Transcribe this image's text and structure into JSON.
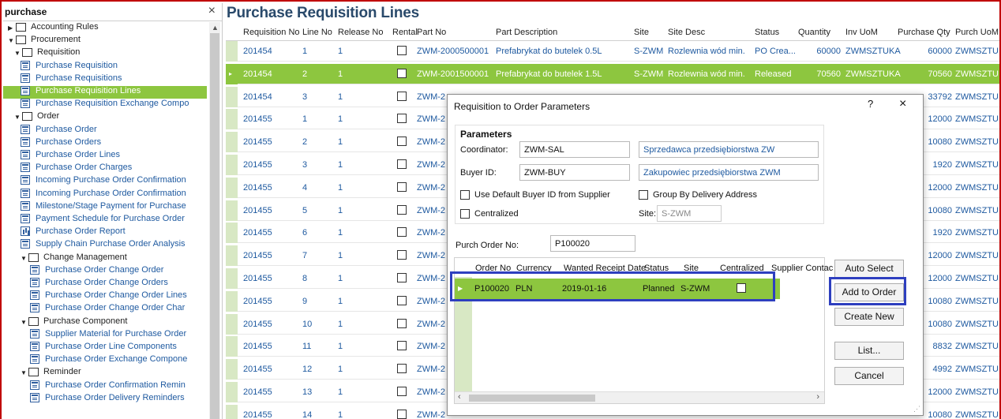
{
  "navigator": {
    "search_value": "purchase",
    "clear_label": "×",
    "tree": [
      {
        "label": "Accounting Rules",
        "level": 0,
        "kind": "folder",
        "arrow": "▶"
      },
      {
        "label": "Procurement",
        "level": 0,
        "kind": "folder",
        "arrow": "▼"
      },
      {
        "label": "Requisition",
        "level": 1,
        "kind": "folder",
        "arrow": "▼"
      },
      {
        "label": "Purchase Requisition",
        "level": 2,
        "kind": "page"
      },
      {
        "label": "Purchase Requisitions",
        "level": 2,
        "kind": "page"
      },
      {
        "label": "Purchase Requisition Lines",
        "level": 2,
        "kind": "page",
        "selected": true
      },
      {
        "label": "Purchase Requisition Exchange Compo",
        "level": 2,
        "kind": "page"
      },
      {
        "label": "Order",
        "level": 1,
        "kind": "folder",
        "arrow": "▼"
      },
      {
        "label": "Purchase Order",
        "level": 2,
        "kind": "page"
      },
      {
        "label": "Purchase Orders",
        "level": 2,
        "kind": "page"
      },
      {
        "label": "Purchase Order Lines",
        "level": 2,
        "kind": "page"
      },
      {
        "label": "Purchase Order Charges",
        "level": 2,
        "kind": "page"
      },
      {
        "label": "Incoming Purchase Order Confirmation",
        "level": 2,
        "kind": "page"
      },
      {
        "label": "Incoming Purchase Order Confirmation",
        "level": 2,
        "kind": "page"
      },
      {
        "label": "Milestone/Stage Payment for Purchase",
        "level": 2,
        "kind": "page"
      },
      {
        "label": "Payment Schedule for Purchase Order",
        "level": 2,
        "kind": "page"
      },
      {
        "label": "Purchase Order Report",
        "level": 2,
        "kind": "chart"
      },
      {
        "label": "Supply Chain Purchase Order Analysis",
        "level": 2,
        "kind": "page"
      },
      {
        "label": "Change Management",
        "level": 2,
        "kind": "folder",
        "arrow": "▼"
      },
      {
        "label": "Purchase Order Change Order",
        "level": 3,
        "kind": "page"
      },
      {
        "label": "Purchase Order Change Orders",
        "level": 3,
        "kind": "page"
      },
      {
        "label": "Purchase Order Change Order Lines",
        "level": 3,
        "kind": "page"
      },
      {
        "label": "Purchase Order Change Order Char",
        "level": 3,
        "kind": "page"
      },
      {
        "label": "Purchase Component",
        "level": 2,
        "kind": "folder",
        "arrow": "▼"
      },
      {
        "label": "Supplier Material for Purchase Order",
        "level": 3,
        "kind": "page"
      },
      {
        "label": "Purchase Order Line Components",
        "level": 3,
        "kind": "page"
      },
      {
        "label": "Purchase Order Exchange Compone",
        "level": 3,
        "kind": "page"
      },
      {
        "label": "Reminder",
        "level": 2,
        "kind": "folder",
        "arrow": "▼"
      },
      {
        "label": "Purchase Order Confirmation Remin",
        "level": 3,
        "kind": "page"
      },
      {
        "label": "Purchase Order Delivery Reminders",
        "level": 3,
        "kind": "page"
      }
    ]
  },
  "page": {
    "title": "Purchase Requisition Lines",
    "columns": [
      "Requisition No",
      "Line No",
      "Release No",
      "Rental",
      "Part No",
      "Part Description",
      "Site",
      "Site Desc",
      "Status",
      "Quantity",
      "Inv UoM",
      "Purchase Qty",
      "Purch UoM"
    ],
    "rows": [
      {
        "req": "201454",
        "line": "1",
        "rel": "1",
        "part": "ZWM-2000500001",
        "desc": "Prefabrykat do butelek 0.5L",
        "site": "S-ZWM",
        "site_desc": "Rozlewnia wód min.",
        "status": "PO Crea...",
        "qty": "60000",
        "inv_uom": "ZWMSZTUKA",
        "pqty": "60000",
        "puom": "ZWMSZTU"
      },
      {
        "req": "201454",
        "line": "2",
        "rel": "1",
        "part": "ZWM-2001500001",
        "desc": "Prefabrykat do butelek 1.5L",
        "site": "S-ZWM",
        "site_desc": "Rozlewnia wód min.",
        "status": "Released",
        "qty": "70560",
        "inv_uom": "ZWMSZTUKA",
        "pqty": "70560",
        "puom": "ZWMSZTU",
        "selected": true
      },
      {
        "req": "201454",
        "line": "3",
        "rel": "1",
        "part": "ZWM-2",
        "pqty": "33792",
        "puom": "ZWMSZTU"
      },
      {
        "req": "201455",
        "line": "1",
        "rel": "1",
        "part": "ZWM-2",
        "pqty": "12000",
        "puom": "ZWMSZTU"
      },
      {
        "req": "201455",
        "line": "2",
        "rel": "1",
        "part": "ZWM-2",
        "pqty": "10080",
        "puom": "ZWMSZTU"
      },
      {
        "req": "201455",
        "line": "3",
        "rel": "1",
        "part": "ZWM-2",
        "pqty": "1920",
        "puom": "ZWMSZTU"
      },
      {
        "req": "201455",
        "line": "4",
        "rel": "1",
        "part": "ZWM-2",
        "pqty": "12000",
        "puom": "ZWMSZTU"
      },
      {
        "req": "201455",
        "line": "5",
        "rel": "1",
        "part": "ZWM-2",
        "pqty": "10080",
        "puom": "ZWMSZTU"
      },
      {
        "req": "201455",
        "line": "6",
        "rel": "1",
        "part": "ZWM-2",
        "pqty": "1920",
        "puom": "ZWMSZTU"
      },
      {
        "req": "201455",
        "line": "7",
        "rel": "1",
        "part": "ZWM-2",
        "pqty": "12000",
        "puom": "ZWMSZTU"
      },
      {
        "req": "201455",
        "line": "8",
        "rel": "1",
        "part": "ZWM-2",
        "pqty": "12000",
        "puom": "ZWMSZTU"
      },
      {
        "req": "201455",
        "line": "9",
        "rel": "1",
        "part": "ZWM-2",
        "pqty": "10080",
        "puom": "ZWMSZTU"
      },
      {
        "req": "201455",
        "line": "10",
        "rel": "1",
        "part": "ZWM-2",
        "pqty": "10080",
        "puom": "ZWMSZTU"
      },
      {
        "req": "201455",
        "line": "11",
        "rel": "1",
        "part": "ZWM-2",
        "pqty": "8832",
        "puom": "ZWMSZTU"
      },
      {
        "req": "201455",
        "line": "12",
        "rel": "1",
        "part": "ZWM-2",
        "pqty": "4992",
        "puom": "ZWMSZTU"
      },
      {
        "req": "201455",
        "line": "13",
        "rel": "1",
        "part": "ZWM-2",
        "pqty": "12000",
        "puom": "ZWMSZTU"
      },
      {
        "req": "201455",
        "line": "14",
        "rel": "1",
        "part": "ZWM-2",
        "pqty": "10080",
        "puom": "ZWMSZTU"
      }
    ]
  },
  "dialog": {
    "title": "Requisition to Order Parameters",
    "help": "?",
    "close": "×",
    "params_title": "Parameters",
    "coordinator_label": "Coordinator:",
    "coordinator_value": "ZWM-SAL",
    "coordinator_desc": "Sprzedawca przedsiębiorstwa ZW",
    "buyer_label": "Buyer ID:",
    "buyer_value": "ZWM-BUY",
    "buyer_desc": "Zakupowiec przedsiębiorstwa ZWM",
    "default_buyer_label": "Use Default Buyer ID from Supplier",
    "group_delivery_label": "Group By Delivery Address",
    "centralized_label": "Centralized",
    "site_label": "Site:",
    "site_value": "S-ZWM",
    "purch_order_label": "Purch Order No:",
    "purch_order_value": "P100020",
    "order_columns": [
      "Order No",
      "Currency",
      "Wanted Receipt Date",
      "Status",
      "Site",
      "Centralized",
      "Supplier Contac"
    ],
    "order_row": {
      "order_no": "P100020",
      "currency": "PLN",
      "date": "2019-01-16",
      "status": "Planned",
      "site": "S-ZWM"
    },
    "buttons": {
      "auto_select": "Auto Select",
      "add_to_order": "Add to Order",
      "create_new": "Create New",
      "list": "List...",
      "cancel": "Cancel"
    }
  },
  "colors": {
    "selected_row": "#8dc63f",
    "highlight_border": "#2e3fbf",
    "frame_border": "#c00000",
    "link": "#1f5aa0"
  }
}
